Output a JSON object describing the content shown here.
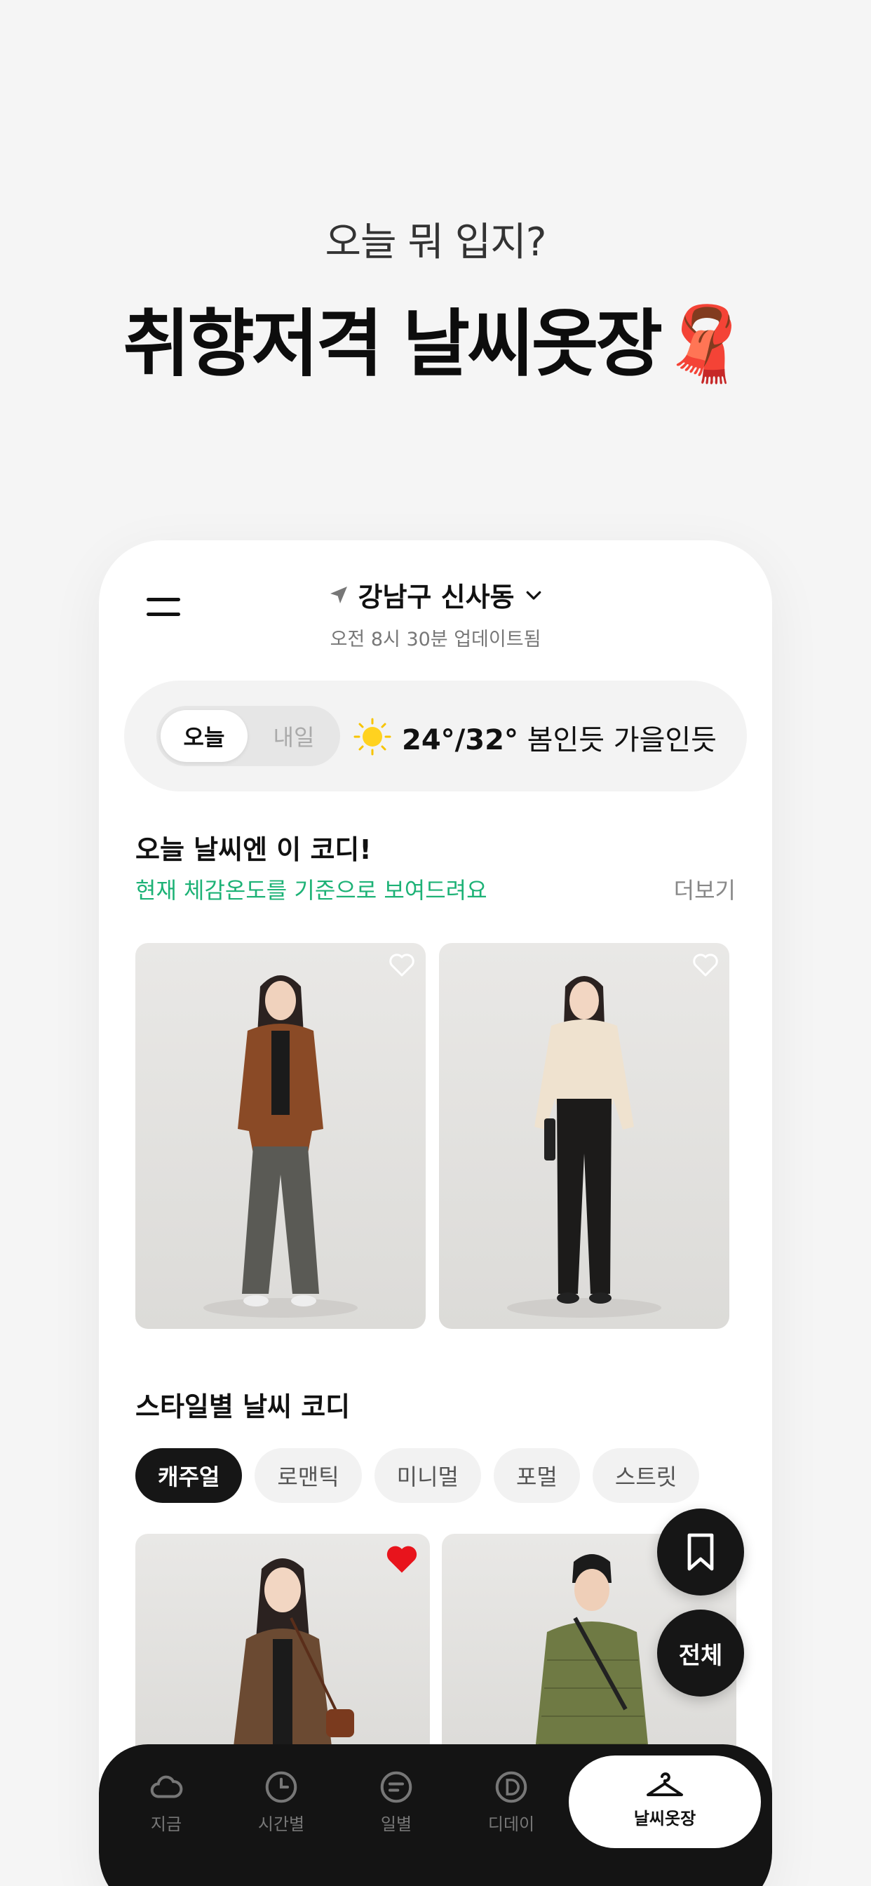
{
  "hero": {
    "subtitle": "오늘 뭐 입지?",
    "title": "취향저격 날씨옷장🧣"
  },
  "header": {
    "location": "강남구 신사동",
    "updated": "오전 8시 30분 업데이트됨"
  },
  "weather": {
    "day_toggle": {
      "selected": "오늘",
      "other": "내일"
    },
    "temperature": "24°/32°",
    "comment": "봄인듯 가을인듯",
    "icon": "sun-icon"
  },
  "today_section": {
    "title": "오늘 날씨엔 이 코디!",
    "subtitle": "현재 체감온도를 기준으로 보여드려요",
    "more_label": "더보기"
  },
  "style_section": {
    "title": "스타일별 날씨 코디",
    "chips": [
      "캐주얼",
      "로맨틱",
      "미니멀",
      "포멀",
      "스트릿"
    ],
    "active_chip": "캐주얼"
  },
  "fab": {
    "bookmark_icon": "bookmark-icon",
    "all_label": "전체"
  },
  "tabs": [
    {
      "label": "지금",
      "icon": "cloud-icon"
    },
    {
      "label": "시간별",
      "icon": "clock-icon"
    },
    {
      "label": "일별",
      "icon": "calendar-list-icon"
    },
    {
      "label": "디데이",
      "icon": "d-day-icon"
    },
    {
      "label": "날씨옷장",
      "icon": "hanger-icon"
    }
  ],
  "active_tab": "날씨옷장",
  "colors": {
    "accent_green": "#1db276",
    "favorite_red": "#e8141c",
    "dark": "#141414"
  }
}
